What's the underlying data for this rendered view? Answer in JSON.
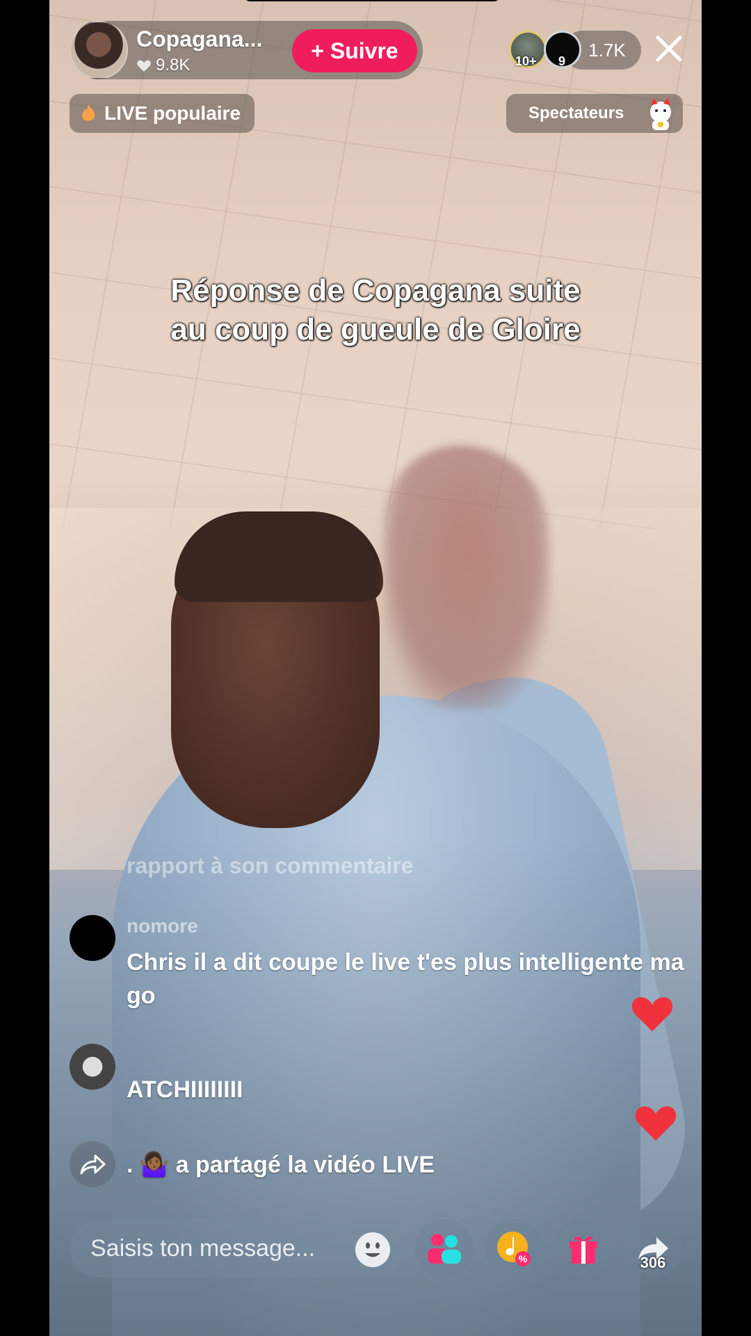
{
  "host": {
    "name": "Copagana...",
    "likes": "9.8K",
    "follow_label": "+ Suivre"
  },
  "viewers": {
    "badge_1": "10+",
    "badge_2": "9",
    "count": "1.7K"
  },
  "badges": {
    "popular_label": "LIVE populaire",
    "spectators_label": "Spectateurs"
  },
  "caption": {
    "line1": "Réponse de Copagana suite",
    "line2": "au coup de gueule de Gloire"
  },
  "chat": {
    "faded_text": "rapport à son commentaire",
    "messages": [
      {
        "user": "nomore",
        "text": "Chris il a dit coupe le live t'es plus intelligente ma go"
      },
      {
        "user": "",
        "text": "ATCHIIIIIIII"
      }
    ],
    "share_event": ". 🤷🏾‍♀️ a partagé la vidéo LIVE"
  },
  "bottom_bar": {
    "message_placeholder": "Saisis ton message...",
    "share_count": "306"
  },
  "icons": {
    "close": "close-icon",
    "heart": "heart-icon",
    "emoji": "emoji-icon",
    "guests": "guests-icon",
    "promo": "promo-icon",
    "gift": "gift-icon",
    "share": "share-icon"
  },
  "colors": {
    "follow": "#f01d5c",
    "heart": "#f0323c",
    "popular_flame": "#f7a348"
  }
}
